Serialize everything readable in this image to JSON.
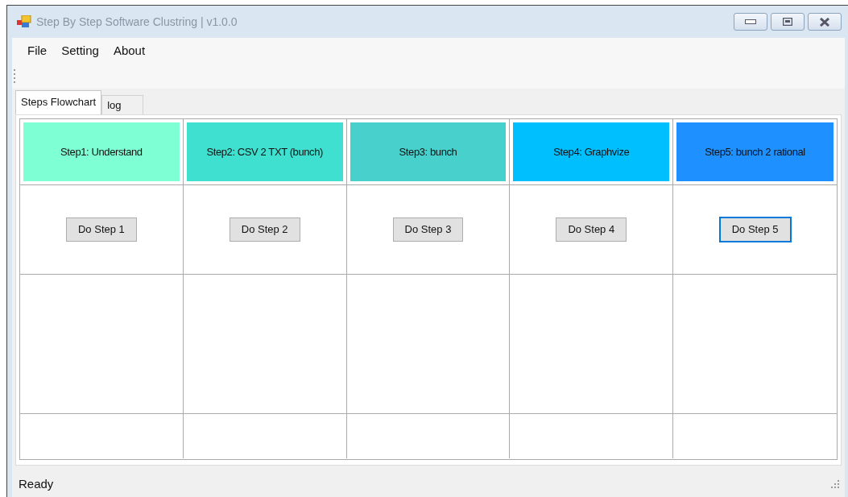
{
  "window": {
    "title": "Step By Step Software Clustring | v1.0.0"
  },
  "menu": [
    "File",
    "Setting",
    "About"
  ],
  "tabs": [
    {
      "label": "Steps Flowchart",
      "selected": true
    },
    {
      "label": "log",
      "selected": false
    }
  ],
  "steps": [
    {
      "title": "Step1:  Understand",
      "color": "#7fffd4",
      "button": "Do Step 1",
      "focused": false
    },
    {
      "title": "Step2:  CSV 2 TXT (bunch)",
      "color": "#40e0d0",
      "button": "Do Step 2",
      "focused": false
    },
    {
      "title": "Step3: bunch",
      "color": "#48d1cc",
      "button": "Do Step 3",
      "focused": false
    },
    {
      "title": "Step4: Graphvize",
      "color": "#00bfff",
      "button": "Do Step 4",
      "focused": false
    },
    {
      "title": "Step5: bunch 2 rational",
      "color": "#1e90ff",
      "button": "Do Step 5",
      "focused": true
    }
  ],
  "status_bar": "Ready"
}
